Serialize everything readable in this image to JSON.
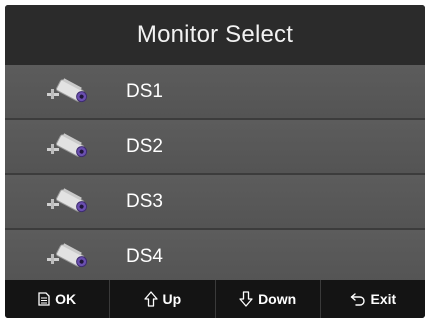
{
  "header": {
    "title": "Monitor Select"
  },
  "monitors": [
    {
      "label": "DS1",
      "icon": "camera-icon"
    },
    {
      "label": "DS2",
      "icon": "camera-icon"
    },
    {
      "label": "DS3",
      "icon": "camera-icon"
    },
    {
      "label": "DS4",
      "icon": "camera-icon"
    }
  ],
  "footer": {
    "ok_label": "OK",
    "up_label": "Up",
    "down_label": "Down",
    "exit_label": "Exit",
    "ok_icon": "document-icon",
    "up_icon": "arrow-up-icon",
    "down_icon": "arrow-down-icon",
    "exit_icon": "return-icon"
  },
  "colors": {
    "background": "#3a3a3a",
    "title_bar": "#2b2b2b",
    "row": "#575757",
    "footer": "#141414",
    "text": "#ffffff",
    "camera_accent": "#6a4fb0"
  }
}
